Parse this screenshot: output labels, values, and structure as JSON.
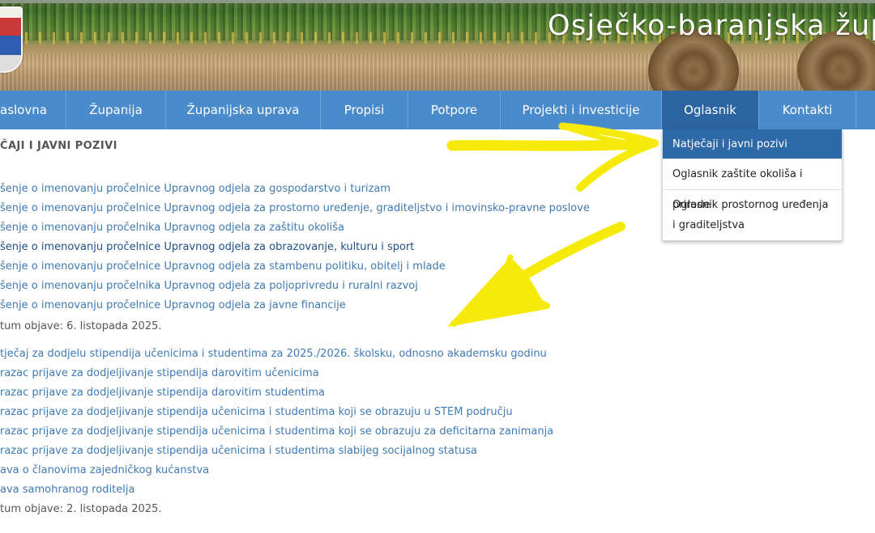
{
  "header": {
    "site_title": "Osječko-baranjska župan"
  },
  "nav": {
    "items": [
      {
        "label": "aslovna"
      },
      {
        "label": "Županija"
      },
      {
        "label": "Županijska uprava"
      },
      {
        "label": "Propisi"
      },
      {
        "label": "Potpore"
      },
      {
        "label": "Projekti i investicije"
      },
      {
        "label": "Oglasnik"
      },
      {
        "label": "Kontakti"
      }
    ],
    "active": "Oglasnik"
  },
  "dropdown": {
    "items": [
      {
        "label": "Natječaji i javni pozivi"
      },
      {
        "label": "Oglasnik zaštite okoliša i prirode"
      },
      {
        "label": "Oglasnik prostornog uređenja i graditeljstva"
      }
    ]
  },
  "content": {
    "section_title": "ČAJI I JAVNI POZIVI",
    "group1": {
      "links": [
        "šenje o imenovanju pročelnice Upravnog odjela za gospodarstvo i turizam",
        "šenje o imenovanju pročelnice Upravnog odjela za prostorno uređenje, graditeljstvo i imovinsko-pravne poslove",
        "šenje o imenovanju pročelnika Upravnog odjela za zaštitu okoliša",
        "šenje o imenovanju pročelnice Upravnog odjela za obrazovanje, kulturu i sport",
        "šenje o imenovanju pročelnice Upravnog odjela za stambenu politiku, obitelj i mlade",
        "šenje o imenovanju pročelnika Upravnog odjela za poljoprivredu i ruralni razvoj",
        "šenje o imenovanju pročelnice Upravnog odjela za javne financije"
      ],
      "date": "tum objave: 6. listopada 2025."
    },
    "group2": {
      "links": [
        "tječaj za dodjelu stipendija učenicima i studentima za 2025./2026. školsku, odnosno akademsku godinu",
        "razac prijave za dodjeljivanje stipendija darovitim učenicima",
        "razac prijave za dodjeljivanje stipendija darovitim studentima",
        "razac prijave za dodjeljivanje stipendija učenicima i studentima koji se obrazuju u STEM području",
        "razac prijave za dodjeljivanje stipendija učenicima i studentima koji se obrazuju za deficitarna zanimanja",
        "razac prijave za dodjeljivanje stipendija učenicima i studentima slabijeg socijalnog statusa",
        "ava o članovima zajedničkog kućanstva",
        "ava samohranog roditelja"
      ],
      "date": "tum objave: 2. listopada 2025."
    }
  },
  "colors": {
    "nav_bg": "#4a8bcb",
    "nav_active": "#2c64a2",
    "dropdown_active": "#2e69a8",
    "link": "#3f7ab3",
    "annotation": "#f6ea0c"
  }
}
